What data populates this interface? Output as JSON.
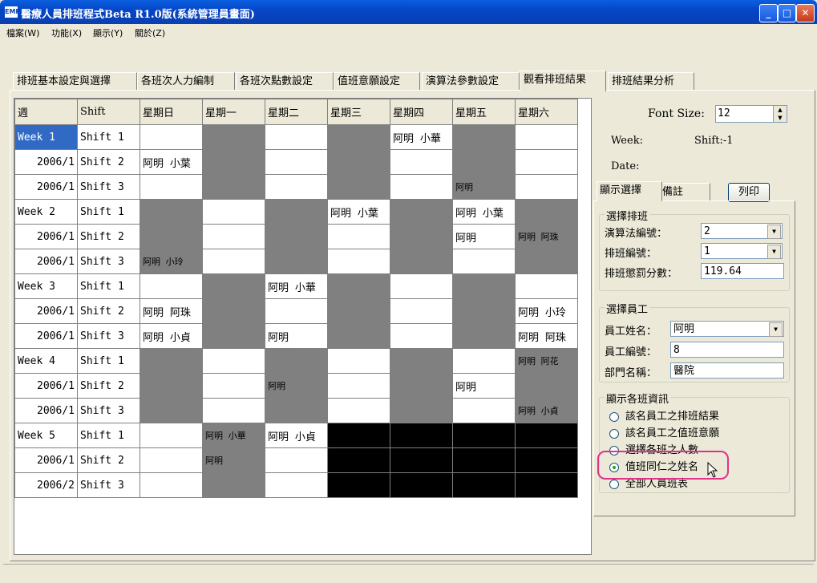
{
  "window": {
    "title": "醫療人員排班程式Beta R1.0版(系統管理員畫面)",
    "icon_text": "EMP",
    "minimize": "_",
    "maximize": "□",
    "close": "✕"
  },
  "menu": [
    "檔案(W)",
    "功能(X)",
    "顯示(Y)",
    "關於(Z)"
  ],
  "tabs": [
    "排班基本設定與選擇",
    "各班次人力編制",
    "各班次點數設定",
    "值班意願設定",
    "演算法參數設定",
    "觀看排班結果",
    "排班結果分析"
  ],
  "active_tab": 5,
  "schedule": {
    "headers": [
      "週",
      "Shift",
      "星期日",
      "星期一",
      "星期二",
      "星期三",
      "星期四",
      "星期五",
      "星期六"
    ],
    "rows": [
      {
        "week": "Week 1",
        "shift": "Shift 1",
        "cells": [
          {
            "t": "",
            "s": "white"
          },
          {
            "t": "",
            "s": "gray"
          },
          {
            "t": "",
            "s": "white"
          },
          {
            "t": "",
            "s": "gray"
          },
          {
            "t": "阿明 小華",
            "s": "white"
          },
          {
            "t": "",
            "s": "gray"
          },
          {
            "t": "",
            "s": "white"
          }
        ]
      },
      {
        "week": "2006/1",
        "shift": "Shift 2",
        "cells": [
          {
            "t": "阿明 小葉",
            "s": "white"
          },
          {
            "t": "",
            "s": "gray"
          },
          {
            "t": "",
            "s": "white"
          },
          {
            "t": "",
            "s": "gray"
          },
          {
            "t": "",
            "s": "white"
          },
          {
            "t": "",
            "s": "gray"
          },
          {
            "t": "",
            "s": "white"
          }
        ]
      },
      {
        "week": "2006/1",
        "shift": "Shift 3",
        "cells": [
          {
            "t": "",
            "s": "white"
          },
          {
            "t": "",
            "s": "gray"
          },
          {
            "t": "",
            "s": "white"
          },
          {
            "t": "",
            "s": "gray"
          },
          {
            "t": "",
            "s": "white"
          },
          {
            "t": "阿明",
            "s": "gray-top"
          },
          {
            "t": "",
            "s": "white"
          }
        ]
      },
      {
        "week": "Week 2",
        "shift": "Shift 1",
        "cells": [
          {
            "t": "",
            "s": "gray"
          },
          {
            "t": "",
            "s": "white"
          },
          {
            "t": "",
            "s": "gray"
          },
          {
            "t": "阿明 小葉",
            "s": "white"
          },
          {
            "t": "",
            "s": "gray"
          },
          {
            "t": "阿明 小葉",
            "s": "white"
          },
          {
            "t": "",
            "s": "gray"
          }
        ]
      },
      {
        "week": "2006/1",
        "shift": "Shift 2",
        "cells": [
          {
            "t": "",
            "s": "gray"
          },
          {
            "t": "",
            "s": "white"
          },
          {
            "t": "",
            "s": "gray"
          },
          {
            "t": "",
            "s": "white"
          },
          {
            "t": "",
            "s": "gray"
          },
          {
            "t": "阿明",
            "s": "white"
          },
          {
            "t": "阿明\n阿珠",
            "s": "gray-multi"
          }
        ]
      },
      {
        "week": "2006/1",
        "shift": "Shift 3",
        "cells": [
          {
            "t": "阿明\n小玲",
            "s": "gray-multi"
          },
          {
            "t": "",
            "s": "white"
          },
          {
            "t": "",
            "s": "gray"
          },
          {
            "t": "",
            "s": "white"
          },
          {
            "t": "",
            "s": "gray"
          },
          {
            "t": "",
            "s": "white"
          },
          {
            "t": "",
            "s": "gray"
          }
        ]
      },
      {
        "week": "Week 3",
        "shift": "Shift 1",
        "cells": [
          {
            "t": "",
            "s": "white"
          },
          {
            "t": "",
            "s": "gray"
          },
          {
            "t": "阿明 小華",
            "s": "white"
          },
          {
            "t": "",
            "s": "gray"
          },
          {
            "t": "",
            "s": "white"
          },
          {
            "t": "",
            "s": "gray"
          },
          {
            "t": "",
            "s": "white"
          }
        ]
      },
      {
        "week": "2006/1",
        "shift": "Shift 2",
        "cells": [
          {
            "t": "阿明 阿珠",
            "s": "white"
          },
          {
            "t": "",
            "s": "gray"
          },
          {
            "t": "",
            "s": "white"
          },
          {
            "t": "",
            "s": "gray"
          },
          {
            "t": "",
            "s": "white"
          },
          {
            "t": "",
            "s": "gray"
          },
          {
            "t": "阿明 小玲",
            "s": "white"
          }
        ]
      },
      {
        "week": "2006/1",
        "shift": "Shift 3",
        "cells": [
          {
            "t": "阿明 小貞",
            "s": "white"
          },
          {
            "t": "",
            "s": "gray"
          },
          {
            "t": "阿明",
            "s": "white"
          },
          {
            "t": "",
            "s": "gray"
          },
          {
            "t": "",
            "s": "white"
          },
          {
            "t": "",
            "s": "gray"
          },
          {
            "t": "阿明 阿珠",
            "s": "white"
          }
        ]
      },
      {
        "week": "Week 4",
        "shift": "Shift 1",
        "cells": [
          {
            "t": "",
            "s": "gray"
          },
          {
            "t": "",
            "s": "white"
          },
          {
            "t": "",
            "s": "gray"
          },
          {
            "t": "",
            "s": "white"
          },
          {
            "t": "",
            "s": "gray"
          },
          {
            "t": "",
            "s": "white"
          },
          {
            "t": "阿明\n阿花",
            "s": "gray-multi"
          }
        ]
      },
      {
        "week": "2006/1",
        "shift": "Shift 2",
        "cells": [
          {
            "t": "",
            "s": "gray"
          },
          {
            "t": "",
            "s": "white"
          },
          {
            "t": "阿明",
            "s": "gray-top"
          },
          {
            "t": "",
            "s": "white"
          },
          {
            "t": "",
            "s": "gray"
          },
          {
            "t": "阿明",
            "s": "white"
          },
          {
            "t": "",
            "s": "gray"
          }
        ]
      },
      {
        "week": "2006/1",
        "shift": "Shift 3",
        "cells": [
          {
            "t": "",
            "s": "gray"
          },
          {
            "t": "",
            "s": "white"
          },
          {
            "t": "",
            "s": "gray"
          },
          {
            "t": "",
            "s": "white"
          },
          {
            "t": "",
            "s": "gray"
          },
          {
            "t": "",
            "s": "white"
          },
          {
            "t": "阿明\n小貞",
            "s": "gray-multi"
          }
        ]
      },
      {
        "week": "Week 5",
        "shift": "Shift 1",
        "cells": [
          {
            "t": "",
            "s": "white"
          },
          {
            "t": "阿明\n小華",
            "s": "gray-multi"
          },
          {
            "t": "阿明 小貞",
            "s": "white"
          },
          {
            "t": "",
            "s": "black"
          },
          {
            "t": "",
            "s": "black"
          },
          {
            "t": "",
            "s": "black"
          },
          {
            "t": "",
            "s": "black"
          }
        ]
      },
      {
        "week": "2006/1",
        "shift": "Shift 2",
        "cells": [
          {
            "t": "",
            "s": "white"
          },
          {
            "t": "阿明",
            "s": "gray-top"
          },
          {
            "t": "",
            "s": "white"
          },
          {
            "t": "",
            "s": "black"
          },
          {
            "t": "",
            "s": "black"
          },
          {
            "t": "",
            "s": "black"
          },
          {
            "t": "",
            "s": "black"
          }
        ]
      },
      {
        "week": "2006/2",
        "shift": "Shift 3",
        "cells": [
          {
            "t": "",
            "s": "white"
          },
          {
            "t": "",
            "s": "gray"
          },
          {
            "t": "",
            "s": "white"
          },
          {
            "t": "",
            "s": "black"
          },
          {
            "t": "",
            "s": "black"
          },
          {
            "t": "",
            "s": "black"
          },
          {
            "t": "",
            "s": "black"
          }
        ]
      }
    ]
  },
  "right": {
    "font_size_label": "Font Size:",
    "font_size_value": "12",
    "week_label": "Week:",
    "shift_label": "Shift:-1",
    "date_label": "Date:",
    "subtabs": [
      "顯示選擇",
      "備註"
    ],
    "print_button": "列印",
    "select_group": {
      "title": "選擇排班",
      "algo_label": "演算法編號：",
      "algo_value": "2",
      "sched_label": "排班編號：",
      "sched_value": "1",
      "penalty_label": "排班懲罰分數：",
      "penalty_value": "119.64"
    },
    "employee_group": {
      "title": "選擇員工",
      "name_label": "員工姓名：",
      "name_value": "阿明",
      "id_label": "員工編號：",
      "id_value": "8",
      "dept_label": "部門名稱：",
      "dept_value": "醫院"
    },
    "display_group": {
      "title": "顯示各班資訊",
      "options": [
        "該名員工之排班結果",
        "該名員工之值班意願",
        "選擇各班之人數",
        "值班同仁之姓名",
        "全部人員班表"
      ],
      "selected": 3
    }
  },
  "colors": {
    "shaded_cell": "#808080",
    "unavailable_cell": "#000000",
    "selection": "#316ac5",
    "highlight_ring": "#e0328a"
  }
}
